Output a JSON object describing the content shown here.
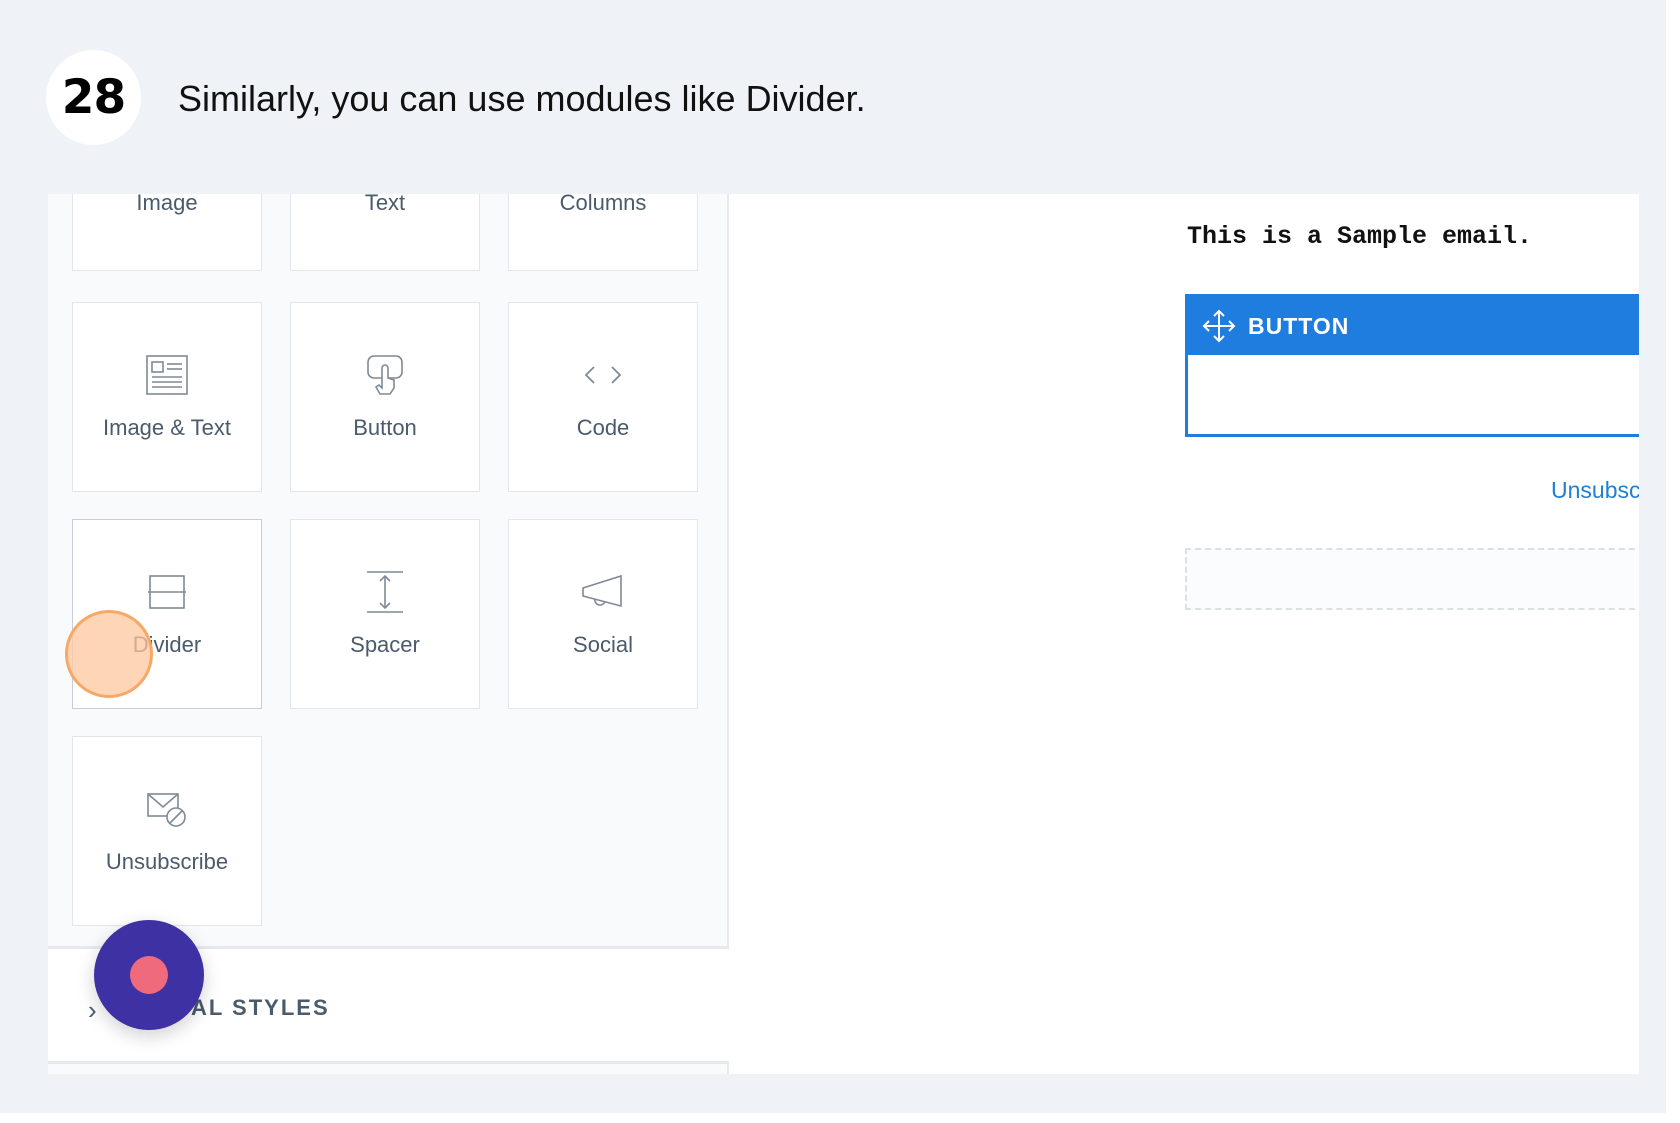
{
  "step": {
    "number": "28",
    "instruction": "Similarly, you can use modules like Divider."
  },
  "modules": {
    "top_row": [
      {
        "label": "Image"
      },
      {
        "label": "Text"
      },
      {
        "label": "Columns"
      }
    ],
    "items": [
      {
        "label": "Image & Text",
        "icon": "image-text-icon"
      },
      {
        "label": "Button",
        "icon": "button-pointer-icon"
      },
      {
        "label": "Code",
        "icon": "code-icon"
      },
      {
        "label": "Divider",
        "icon": "divider-icon"
      },
      {
        "label": "Spacer",
        "icon": "spacer-icon"
      },
      {
        "label": "Social",
        "icon": "megaphone-icon"
      },
      {
        "label": "Unsubscribe",
        "icon": "unsubscribe-mail-icon"
      }
    ],
    "active": "Divider"
  },
  "global_styles": {
    "label": "AL STYLES"
  },
  "email": {
    "sample_text": "This is a Sample email.",
    "button_label": "BUTTON",
    "unsubscribe_link": "Unsubsc"
  },
  "colors": {
    "accent": "#1f7ddf",
    "record_button": "#3d31a4",
    "record_dot": "#ef6a7a",
    "click_marker": "#fdc79e"
  }
}
